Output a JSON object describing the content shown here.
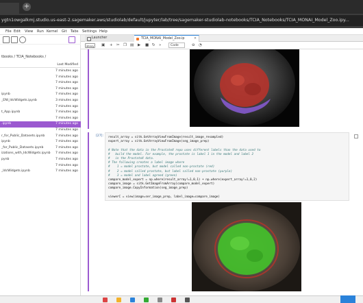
{
  "browser": {
    "url": "ygtn1owgalkmj.studio.us-east-2.sagemaker.aws/studiolab/default/jupyter/lab/tree/sagemaker-studiolab-notebooks/TCIA_Notebooks/TCIA_MONAI_Model_Zoo.ipy...",
    "new_tab": "+"
  },
  "menu": [
    "File",
    "Edit",
    "View",
    "Run",
    "Kernel",
    "Git",
    "Tabs",
    "Settings",
    "Help"
  ],
  "filebrowser": {
    "breadcrumb": "tbooks / TCIA_Notebooks /",
    "column_modified": "Last Modified",
    "rows": [
      {
        "name": "",
        "modified": "7 minutes ago"
      },
      {
        "name": "",
        "modified": "7 minutes ago"
      },
      {
        "name": "",
        "modified": "7 minutes ago"
      },
      {
        "name": "",
        "modified": "7 minutes ago"
      },
      {
        "name": "ipynb",
        "modified": "7 minutes ago"
      },
      {
        "name": "_ENI_IdcWidgets.ipynb",
        "modified": "3 minutes ago"
      },
      {
        "name": "",
        "modified": "7 minutes ago"
      },
      {
        "name": "t_App.ipynb",
        "modified": "7 minutes ago"
      },
      {
        "name": "",
        "modified": "7 minutes ago"
      },
      {
        "name": ".ipynb",
        "modified": "7 minutes ago"
      },
      {
        "name": "",
        "modified": "7 minutes ago"
      },
      {
        "name": "r_for_Public_Datasets.ipynb",
        "modified": "7 minutes ago"
      },
      {
        "name": "ipynb",
        "modified": "7 minutes ago"
      },
      {
        "name": "_for_Public_Datasets.ipynb",
        "modified": "7 minutes ago"
      },
      {
        "name": "izations_with_IdcWidgets.ipynb",
        "modified": "7 minutes ago"
      },
      {
        "name": "pynb",
        "modified": "7 minutes ago"
      },
      {
        "name": "",
        "modified": "7 minutes ago"
      },
      {
        "name": "_IdcWidgets.ipynb",
        "modified": "7 minutes ago"
      }
    ],
    "selected_index": 9
  },
  "tabs": {
    "launcher": "Launcher",
    "notebook": "TCIA_MONAI_Model_Zoo.ip"
  },
  "toolbar": {
    "kernel_badge": "imnsy",
    "cell_type": "Code"
  },
  "cell": {
    "prompt": "[27]:",
    "lines": [
      {
        "text": "result_array = sitk.GetArrayViewFromImage(result_image_resampled)",
        "comment": false
      },
      {
        "text": "expert_array = sitk.GetArrayViewFromImage(seg_image_prep)",
        "comment": false
      },
      {
        "text": "",
        "comment": false
      },
      {
        "text": "# Note that the data in the ProstateX repo uses different labels than the data used to",
        "comment": true
      },
      {
        "text": "#   build the model. For example, the prostate is label 1 in the model and label 2",
        "comment": true
      },
      {
        "text": "#   in the ProstateX data.",
        "comment": true
      },
      {
        "text": "# The following creates a label image where",
        "comment": true
      },
      {
        "text": "#    1 = model prostate, but model called non-prostate (red)",
        "comment": true
      },
      {
        "text": "#    2 = model called prostate, but label called non-prostate (purple)",
        "comment": true
      },
      {
        "text": "#    3 = model and label agreed (green)",
        "comment": true
      },
      {
        "text": "compare_model_expert = np.where(result_array!=1,0,1) + np.where(expert_array!=1,0,2)",
        "comment": false
      },
      {
        "text": "compare_image = sitk.GetImageFromArray(compare_model_expert)",
        "comment": false
      },
      {
        "text": "compare_image.CopyInformation(seg_image_prep)",
        "comment": false
      },
      {
        "text": "",
        "comment": false
      },
      {
        "text": "viewerC = view(image=ser_image_prep, label_image=compare_image)",
        "comment": false
      }
    ]
  },
  "colors": {
    "accent": "#2a82da",
    "selection": "#9b59d0",
    "overlay_red": "#b8322a",
    "overlay_purple": "#8a5cd6",
    "overlay_green": "#43c22a"
  },
  "icons": [
    "new-folder-icon",
    "upload-icon",
    "refresh-icon",
    "git-icon",
    "save-icon",
    "add-cell-icon",
    "cut-icon",
    "copy-icon",
    "paste-icon",
    "run-icon",
    "stop-icon",
    "restart-icon",
    "fast-forward-icon",
    "git-diff-icon",
    "gauge-icon",
    "copy-cell-icon"
  ]
}
